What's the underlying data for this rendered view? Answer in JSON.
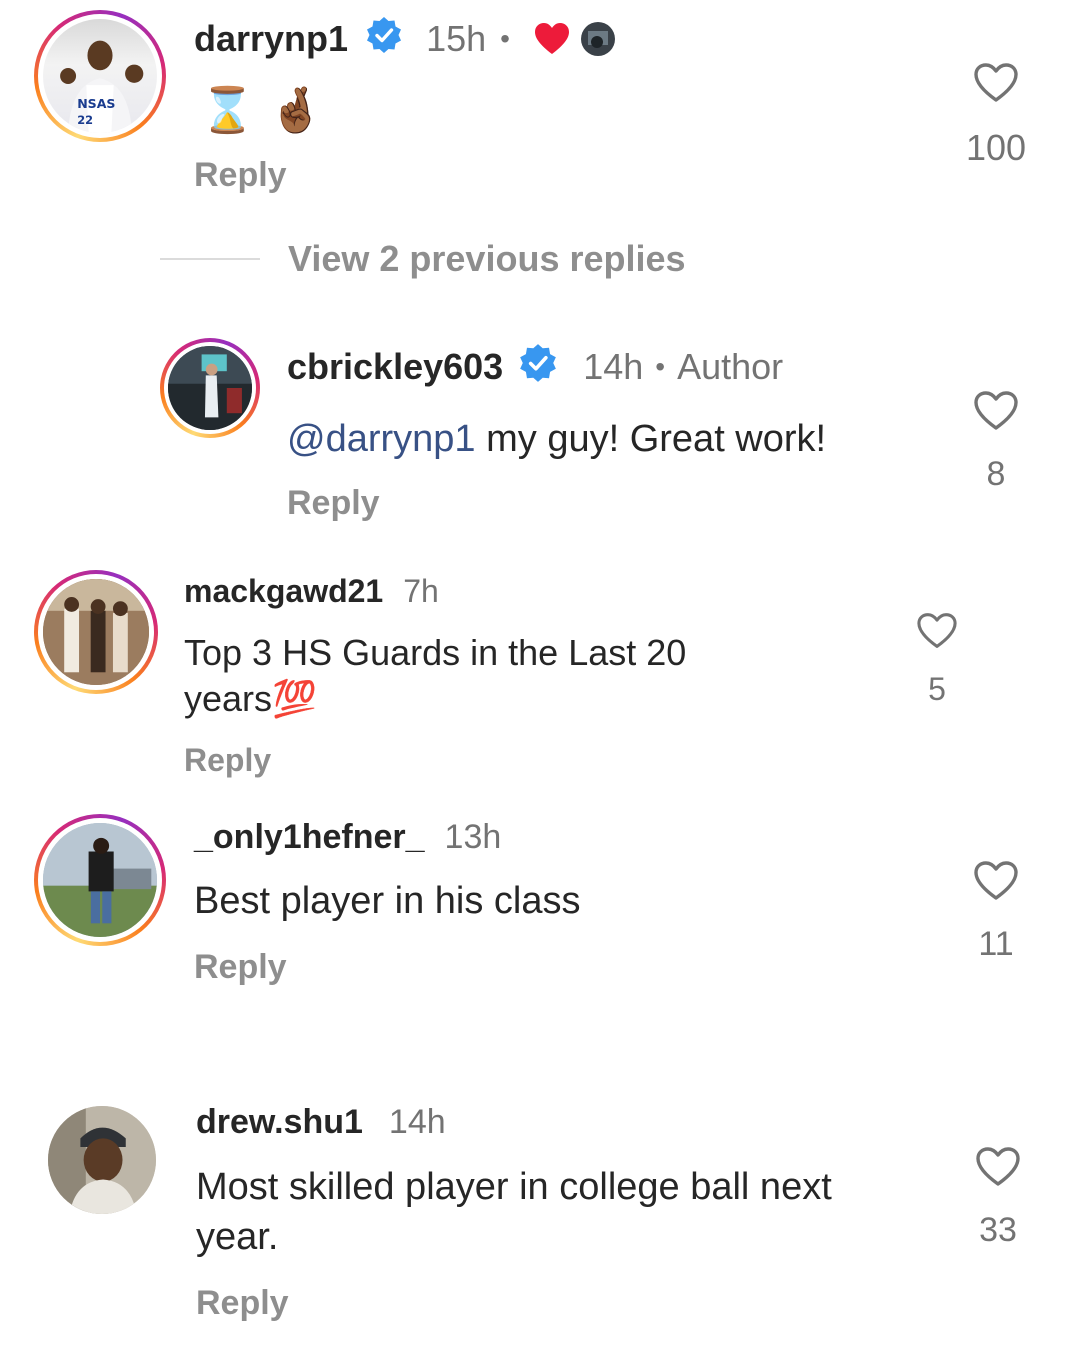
{
  "comments": [
    {
      "username": "darrynp1",
      "time": "15h",
      "separator": "•",
      "text_emoji": "⌛ 🤞🏾",
      "reply_label": "Reply",
      "likes": "100"
    },
    {
      "view_replies": "View 2 previous replies"
    },
    {
      "username": "cbrickley603",
      "time": "14h",
      "separator": "•",
      "author_badge": "Author",
      "mention": "@darrynp1",
      "text": " my guy! Great work!",
      "reply_label": "Reply",
      "likes": "8"
    },
    {
      "username": "mackgawd21",
      "time": "7h",
      "text_line1": "Top 3 HS Guards in the Last 20",
      "text_line2": "years💯",
      "reply_label": "Reply",
      "likes": "5"
    },
    {
      "username": "_only1hefner_",
      "time": "13h",
      "text": "Best player in his class",
      "reply_label": "Reply",
      "likes": "11"
    },
    {
      "username": "drew.shu1",
      "time": "14h",
      "text_line1": "Most skilled player in college ball next",
      "text_line2": "year.",
      "reply_label": "Reply",
      "likes": "33"
    }
  ],
  "colors": {
    "text": "#262626",
    "secondary": "#737373",
    "reply": "#8e8e8e",
    "mention": "#385185",
    "verified": "#3897f0",
    "heart_red": "#ed1b3a"
  },
  "icons": {
    "verified": "verified-badge-icon",
    "like": "heart-outline-icon",
    "liked_by_author": "heart-filled-icon"
  }
}
